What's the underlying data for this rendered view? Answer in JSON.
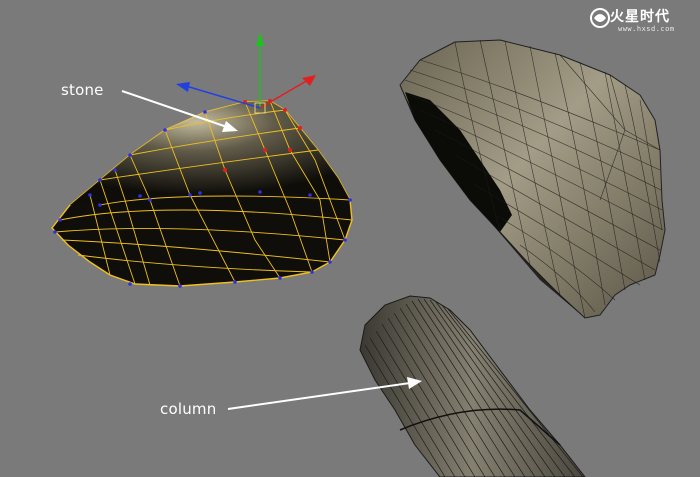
{
  "viewport": {
    "background": "#7a7a7a"
  },
  "watermark": {
    "title": "火星时代",
    "url": "www.hxsd.com"
  },
  "labels": {
    "stone": "stone",
    "column": "column"
  },
  "gizmo": {
    "x_axis_color": "#e02020",
    "y_axis_color": "#20c020",
    "z_axis_color": "#2040e0"
  },
  "objects": [
    {
      "name": "stone",
      "state": "selected",
      "wire_color": "#f0c020",
      "surface_color": "#0f0e0a"
    },
    {
      "name": "column",
      "state": "unselected",
      "wire_color": "#111111",
      "surface_color": "#6e6a5c"
    },
    {
      "name": "rock-large",
      "state": "unselected",
      "wire_color": "#111111",
      "surface_color": "#8a8470"
    }
  ]
}
